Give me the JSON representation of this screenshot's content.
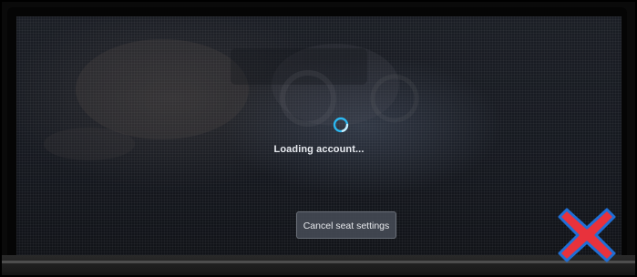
{
  "status": {
    "loading_text": "Loading account..."
  },
  "actions": {
    "cancel_label": "Cancel seat settings"
  },
  "icons": {
    "spinner": "loading-spinner-icon",
    "overlay": "red-x-icon"
  },
  "colors": {
    "spinner_accent": "#2bb7f0",
    "overlay_red": "#e8323c",
    "screen_background": "#161920"
  }
}
